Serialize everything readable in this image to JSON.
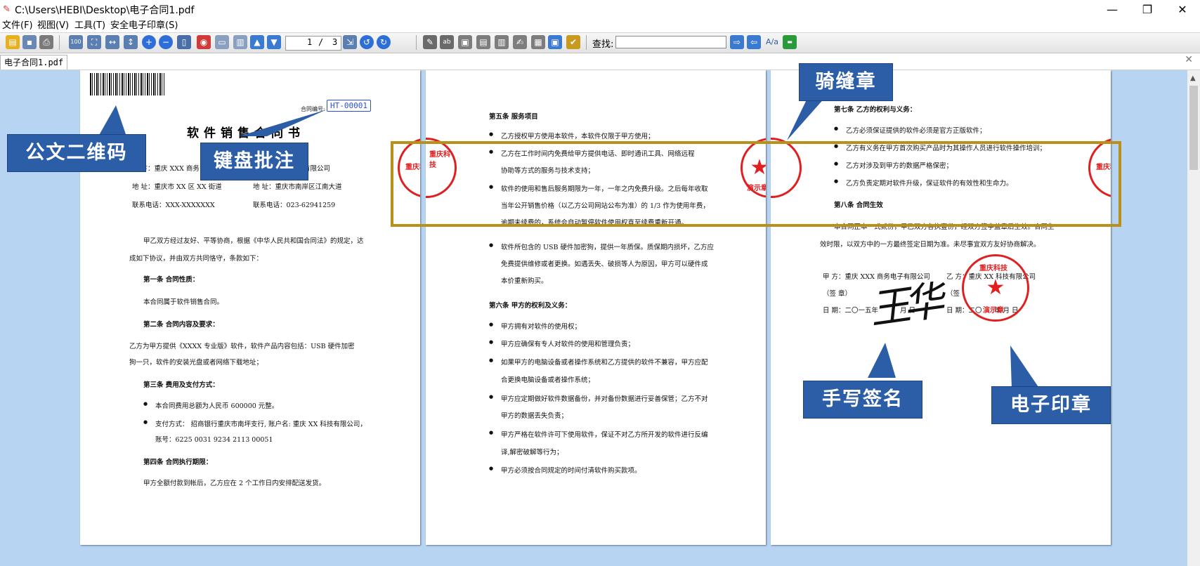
{
  "window": {
    "title": "C:\\Users\\HEBI\\Desktop\\电子合同1.pdf",
    "minimize": "—",
    "restore": "❐",
    "close": "✕"
  },
  "menu": [
    "文件(F)",
    "视图(V)",
    "工具(T)",
    "安全电子印章(S)"
  ],
  "toolbar": {
    "current_page": "1",
    "page_sep": "/",
    "total_pages": "3",
    "find_label": "查找:",
    "find_value": "",
    "find_aa": "A/a"
  },
  "tab": {
    "label": "电子合同1.pdf",
    "close": "✕"
  },
  "page1": {
    "contract_no_label": "合同编号:",
    "contract_no": "HT-00001",
    "title": "软件销售合同书",
    "party_a_line": "甲  方：重庆 XXX 商务电",
    "party_b_line": "有限公司",
    "addr_a": "地  址：重庆市 XX 区 XX 街道",
    "addr_b": "地  址：重庆市南岸区江南大道",
    "tel_a": "联系电话：XXX-XXXXXXX",
    "tel_b": "联系电话：023-62941259",
    "intro1": "甲乙双方经过友好、平等协商，根据《中华人民共和国合同法》的规定，达",
    "intro2": "成如下协议，并由双方共同恪守，条款如下：",
    "a1_title": "第一条  合同性质：",
    "a1_body": "本合同属于软件销售合同。",
    "a2_title": "第二条  合同内容及要求：",
    "a2_body1": "乙方为甲方提供《XXXX 专业版》软件，软件产品内容包括：USB 硬件加密",
    "a2_body2": "狗一只，软件的安装光盘或者网络下载地址；",
    "a3_title": "第三条  费用及支付方式：",
    "a3_b1": "本合同费用总额为人民币 600000 元整。",
    "a3_b2": "支付方式：  招商银行重庆市南坪支行, 账户名: 重庆 XX 科技有限公司，",
    "a3_b2b": "账号：6225 0031 9234 2113 00051",
    "a4_title": "第四条  合同执行期限：",
    "a4_body": "甲方全额付款到帐后，乙方应在 2 个工作日内安排配送发货。"
  },
  "page2": {
    "a5_title": "第五条  服务项目",
    "b1": "乙方授权甲方使用本软件，本软件仅限于甲方使用；",
    "b2": "乙方在工作时间内免费给甲方提供电话、即时通讯工具、网络远程",
    "b2b": "协助等方式的服务与技术支持；",
    "b3": "软件的使用和售后服务期限为一年，一年之内免费升级。之后每年收取",
    "b3b": "当年公开销售价格（以乙方公司网站公布为准）的  1/3  作为使用年费，",
    "b3c": "逾期未续费的，系统会自动暂停软件使用权直至续费重新开通。",
    "b4": "软件所包含的 USB 硬件加密狗，提供一年质保。质保期内损坏，乙方应",
    "b4b": "免费提供维修或者更换。如遇丢失、破损等人为原因，甲方可以硬件成",
    "b4c": "本价重新购买。",
    "a6_title": "第六条  甲方的权利及义务：",
    "c1": "甲方拥有对软件的使用权；",
    "c2": "甲方应确保有专人对软件的使用和管理负责；",
    "c3": "如果甲方的电脑设备或者操作系统和乙方提供的软件不兼容，甲方应配",
    "c3b": "合更换电脑设备或者操作系统；",
    "c4": "甲方应定期做好软件数据备份，并对备份数据进行妥善保管；乙方不对",
    "c4b": "甲方的数据丢失负责；",
    "c5": "甲方严格在软件许可下使用软件，保证不对乙方所开发的软件进行反编",
    "c5b": "译,解密破解等行为；",
    "c6": "甲方必须按合同规定的时间付清软件购买款项。"
  },
  "page3": {
    "a7_title": "第七条  乙方的权利与义务：",
    "d1": "乙方必须保证提供的软件必须是官方正版软件；",
    "d2": "乙方有义务在甲方首次购买产品时为其操作人员进行软件操作培训；",
    "d3": "乙方对涉及到甲方的数据严格保密；",
    "d4": "乙方负责定期对软件升级，保证软件的有效性和生命力。",
    "a8_title": "第八条  合同生效",
    "e1": "本合同正本一式贰份，甲乙双方各执壹份，经双方签字盖章后生效。合同生",
    "e2": "效时限，以双方中的一方最终签定日期为准。未尽事宜双方友好协商解决。",
    "sign_a": "甲    方：重庆 XXX 商务电子有限公司",
    "sign_b": "乙    方：重庆 XX 科技有限公司",
    "seal_label_a": "（签    章）",
    "seal_label_b": "（签",
    "date_a": "日    期：二〇一五年",
    "date_a2": "月 日",
    "date_b": "日    期：二〇",
    "date_b2": "年 月 日",
    "signature": "王华"
  },
  "seals": {
    "seal_text_top": "重庆科技",
    "seal_text_bottom": "演示章"
  },
  "callouts": {
    "qr": "公文二维码",
    "keyboard": "键盘批注",
    "riding": "骑缝章",
    "handwrite": "手写签名",
    "esign": "电子印章"
  },
  "colors": {
    "callout_bg": "#2c5ea8",
    "seal_red": "#e02020",
    "gold_frame": "#b8901a",
    "workspace_bg": "#b7d4f3"
  }
}
